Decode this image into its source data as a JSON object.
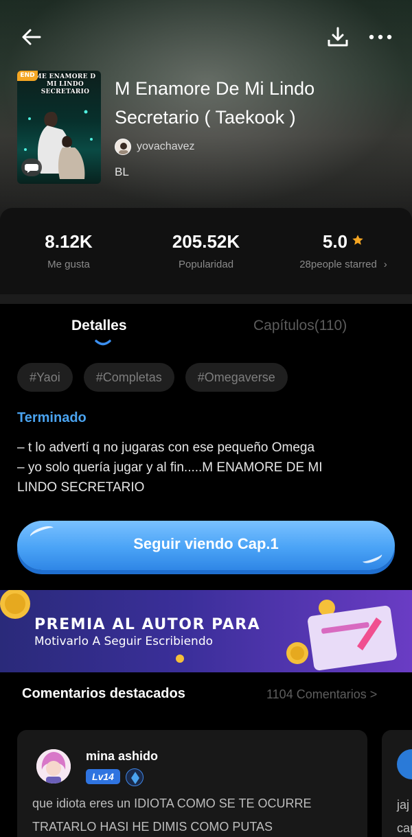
{
  "book": {
    "cover_title": "ME ENAMORE D MI LINDO SECRETARIO",
    "end_badge": "END",
    "title": "M Enamore De Mi Lindo Secretario ( Taekook )",
    "author": "yovachavez",
    "genre": "BL"
  },
  "icons": {
    "back": "back-arrow-icon",
    "download": "download-icon",
    "more": "more-dots-icon",
    "star": "star-icon",
    "chevron": "chevron-right-icon"
  },
  "stats": {
    "likes_value": "8.12K",
    "likes_label": "Me gusta",
    "popularity_value": "205.52K",
    "popularity_label": "Popularidad",
    "rating_value": "5.0",
    "rating_label": "28people starred",
    "rating_chevron": "›"
  },
  "tabs": {
    "details": "Detalles",
    "chapters": "Capítulos(110)"
  },
  "tags": [
    "#Yaoi",
    "#Completas",
    "#Omegaverse"
  ],
  "status": "Terminado",
  "synopsis": {
    "line1": "– t lo advertí q no jugaras con ese pequeño Omega",
    "line2": "– yo solo quería jugar y al fin.....M ENAMORE DE MI",
    "line3": "LINDO SECRETARIO"
  },
  "cta": {
    "label": "Seguir viendo Cap.1"
  },
  "banner": {
    "title": "PREMIA AL AUTOR PARA",
    "subtitle": "Motivarlo A Seguir Escribiendo"
  },
  "comments": {
    "heading": "Comentarios destacados",
    "count": "1104 Comentarios >",
    "items": [
      {
        "user": "mina ashido",
        "level": "Lv14",
        "text1": "que idiota eres un IDIOTA COMO SE TE OCURRE",
        "text2": "TRATARLO HASI HE DIMIS COMO PUTAS"
      },
      {
        "text1": "jaj",
        "text2": "cap"
      }
    ]
  },
  "colors": {
    "accent_blue": "#4aa3ef",
    "star_gold": "#f5a623",
    "background": "#000000"
  }
}
